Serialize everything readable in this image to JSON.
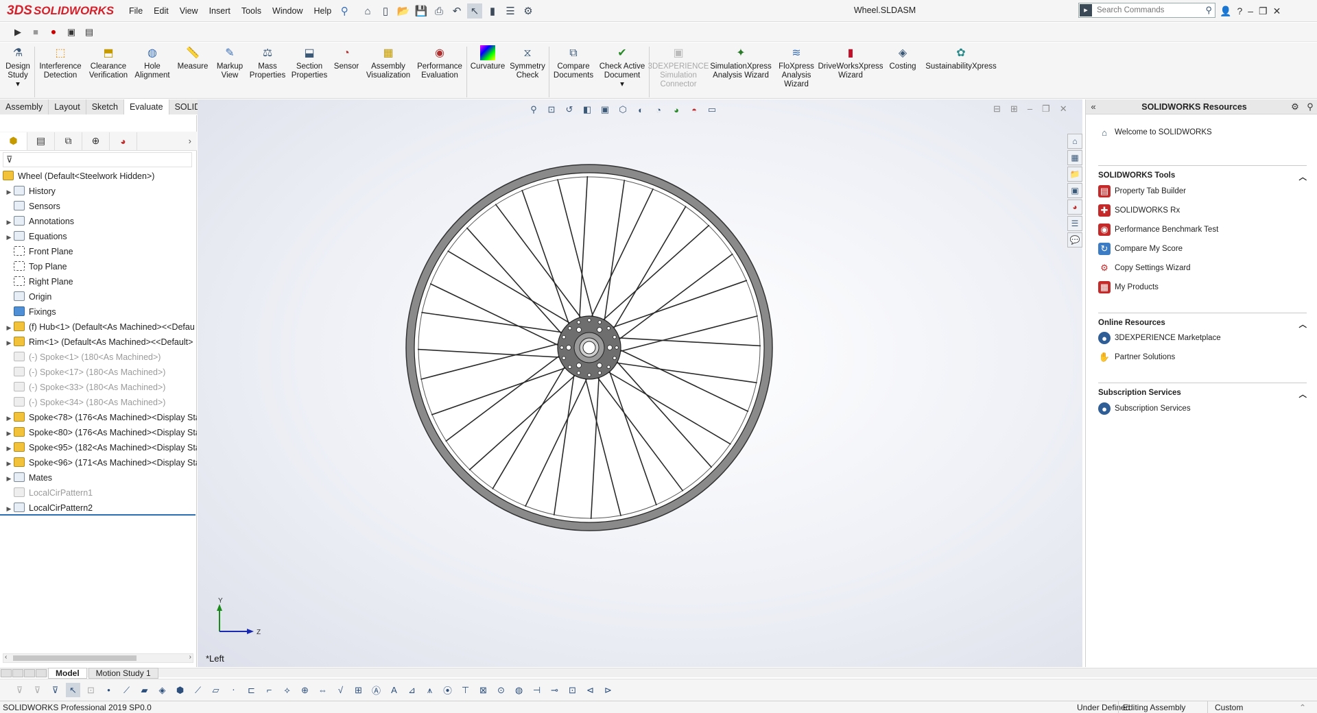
{
  "app": {
    "logo_ds": "3DS",
    "logo_text": "SOLIDWORKS",
    "document_title": "Wheel.SLDASM"
  },
  "menu": [
    "File",
    "Edit",
    "View",
    "Insert",
    "Tools",
    "Window",
    "Help"
  ],
  "search": {
    "placeholder": "Search Commands"
  },
  "command_manager": [
    {
      "label1": "Design",
      "label2": "Study",
      "icon": "design-study-icon"
    },
    {
      "label1": "Interference",
      "label2": "Detection",
      "icon": "interference-detection-icon"
    },
    {
      "label1": "Clearance",
      "label2": "Verification",
      "icon": "clearance-verification-icon"
    },
    {
      "label1": "Hole",
      "label2": "Alignment",
      "icon": "hole-alignment-icon"
    },
    {
      "label1": "Measure",
      "label2": "",
      "icon": "measure-icon"
    },
    {
      "label1": "Markup",
      "label2": "View",
      "icon": "markup-icon"
    },
    {
      "label1": "Mass",
      "label2": "Properties",
      "icon": "mass-properties-icon"
    },
    {
      "label1": "Section",
      "label2": "Properties",
      "icon": "section-properties-icon"
    },
    {
      "label1": "Sensor",
      "label2": "",
      "icon": "sensor-icon"
    },
    {
      "label1": "Assembly",
      "label2": "Visualization",
      "icon": "assembly-visualization-icon"
    },
    {
      "label1": "Performance",
      "label2": "Evaluation",
      "icon": "performance-evaluation-icon"
    },
    {
      "label1": "Curvature",
      "label2": "",
      "icon": "curvature-icon"
    },
    {
      "label1": "Symmetry",
      "label2": "Check",
      "icon": "symmetry-check-icon"
    },
    {
      "label1": "Compare",
      "label2": "Documents",
      "icon": "compare-documents-icon"
    },
    {
      "label1": "Check Active",
      "label2": "Document",
      "icon": "check-active-document-icon"
    },
    {
      "label1": "3DEXPERIENCE",
      "label2": "Simulation",
      "label3": "Connector",
      "icon": "simulation-connector-icon"
    },
    {
      "label1": "SimulationXpress",
      "label2": "Analysis Wizard",
      "icon": "simulationxpress-icon"
    },
    {
      "label1": "FloXpress",
      "label2": "Analysis",
      "label3": "Wizard",
      "icon": "floxpress-icon"
    },
    {
      "label1": "DriveWorksXpress",
      "label2": "Wizard",
      "icon": "driveworksxpress-icon"
    },
    {
      "label1": "Costing",
      "label2": "",
      "icon": "costing-icon"
    },
    {
      "label1": "SustainabilityXpress",
      "label2": "",
      "icon": "sustainability-icon"
    }
  ],
  "command_tabs": [
    "Assembly",
    "Layout",
    "Sketch",
    "Evaluate",
    "SOLIDWORKS Add-Ins"
  ],
  "active_command_tab": "Evaluate",
  "tree": [
    {
      "label": "Wheel  (Default<Steelwork Hidden>)",
      "type": "root"
    },
    {
      "label": "History",
      "expand": true
    },
    {
      "label": "Sensors"
    },
    {
      "label": "Annotations",
      "expand": true
    },
    {
      "label": "Equations",
      "expand": true
    },
    {
      "label": "Front Plane",
      "type": "plane"
    },
    {
      "label": "Top Plane",
      "type": "plane"
    },
    {
      "label": "Right Plane",
      "type": "plane"
    },
    {
      "label": "Origin"
    },
    {
      "label": "Fixings",
      "type": "folder"
    },
    {
      "label": "(f) Hub<1> (Default<As Machined><<Defau",
      "expand": true,
      "type": "part"
    },
    {
      "label": "Rim<1> (Default<As Machined><<Default>",
      "expand": true,
      "type": "part"
    },
    {
      "label": "(-) Spoke<1> (180<As Machined>)",
      "type": "suppressed"
    },
    {
      "label": "(-) Spoke<17> (180<As Machined>)",
      "type": "suppressed"
    },
    {
      "label": "(-) Spoke<33> (180<As Machined>)",
      "type": "suppressed"
    },
    {
      "label": "(-) Spoke<34> (180<As Machined>)",
      "type": "suppressed"
    },
    {
      "label": "Spoke<78> (176<As Machined><Display Sta",
      "expand": true,
      "type": "part"
    },
    {
      "label": "Spoke<80> (176<As Machined><Display Sta",
      "expand": true,
      "type": "part"
    },
    {
      "label": "Spoke<95> (182<As Machined><Display Sta",
      "expand": true,
      "type": "part"
    },
    {
      "label": "Spoke<96> (171<As Machined><Display Sta",
      "expand": true,
      "type": "part"
    },
    {
      "label": "Mates",
      "expand": true
    },
    {
      "label": "LocalCirPattern1",
      "type": "suppressed"
    },
    {
      "label": "LocalCirPattern2",
      "expand": true
    }
  ],
  "viewport": {
    "view_name": "*Left",
    "triad_y": "Y",
    "triad_z": "Z"
  },
  "resources": {
    "title": "SOLIDWORKS Resources",
    "welcome": "Welcome to SOLIDWORKS",
    "tools_title": "SOLIDWORKS Tools",
    "tools": [
      "Property Tab Builder",
      "SOLIDWORKS Rx",
      "Performance Benchmark Test",
      "Compare My Score",
      "Copy Settings Wizard",
      "My Products"
    ],
    "online_title": "Online Resources",
    "online": [
      "3DEXPERIENCE Marketplace",
      "Partner Solutions"
    ],
    "subs_title": "Subscription Services",
    "subs": [
      "Subscription Services"
    ]
  },
  "bottom_tabs": [
    "Model",
    "Motion Study 1"
  ],
  "status": {
    "product": "SOLIDWORKS Professional 2019 SP0.0",
    "defined": "Under Defined",
    "mode": "Editing Assembly",
    "units": "Custom"
  },
  "colors": {
    "logo_red": "#d3202a",
    "selection_blue": "#2b6db3"
  }
}
